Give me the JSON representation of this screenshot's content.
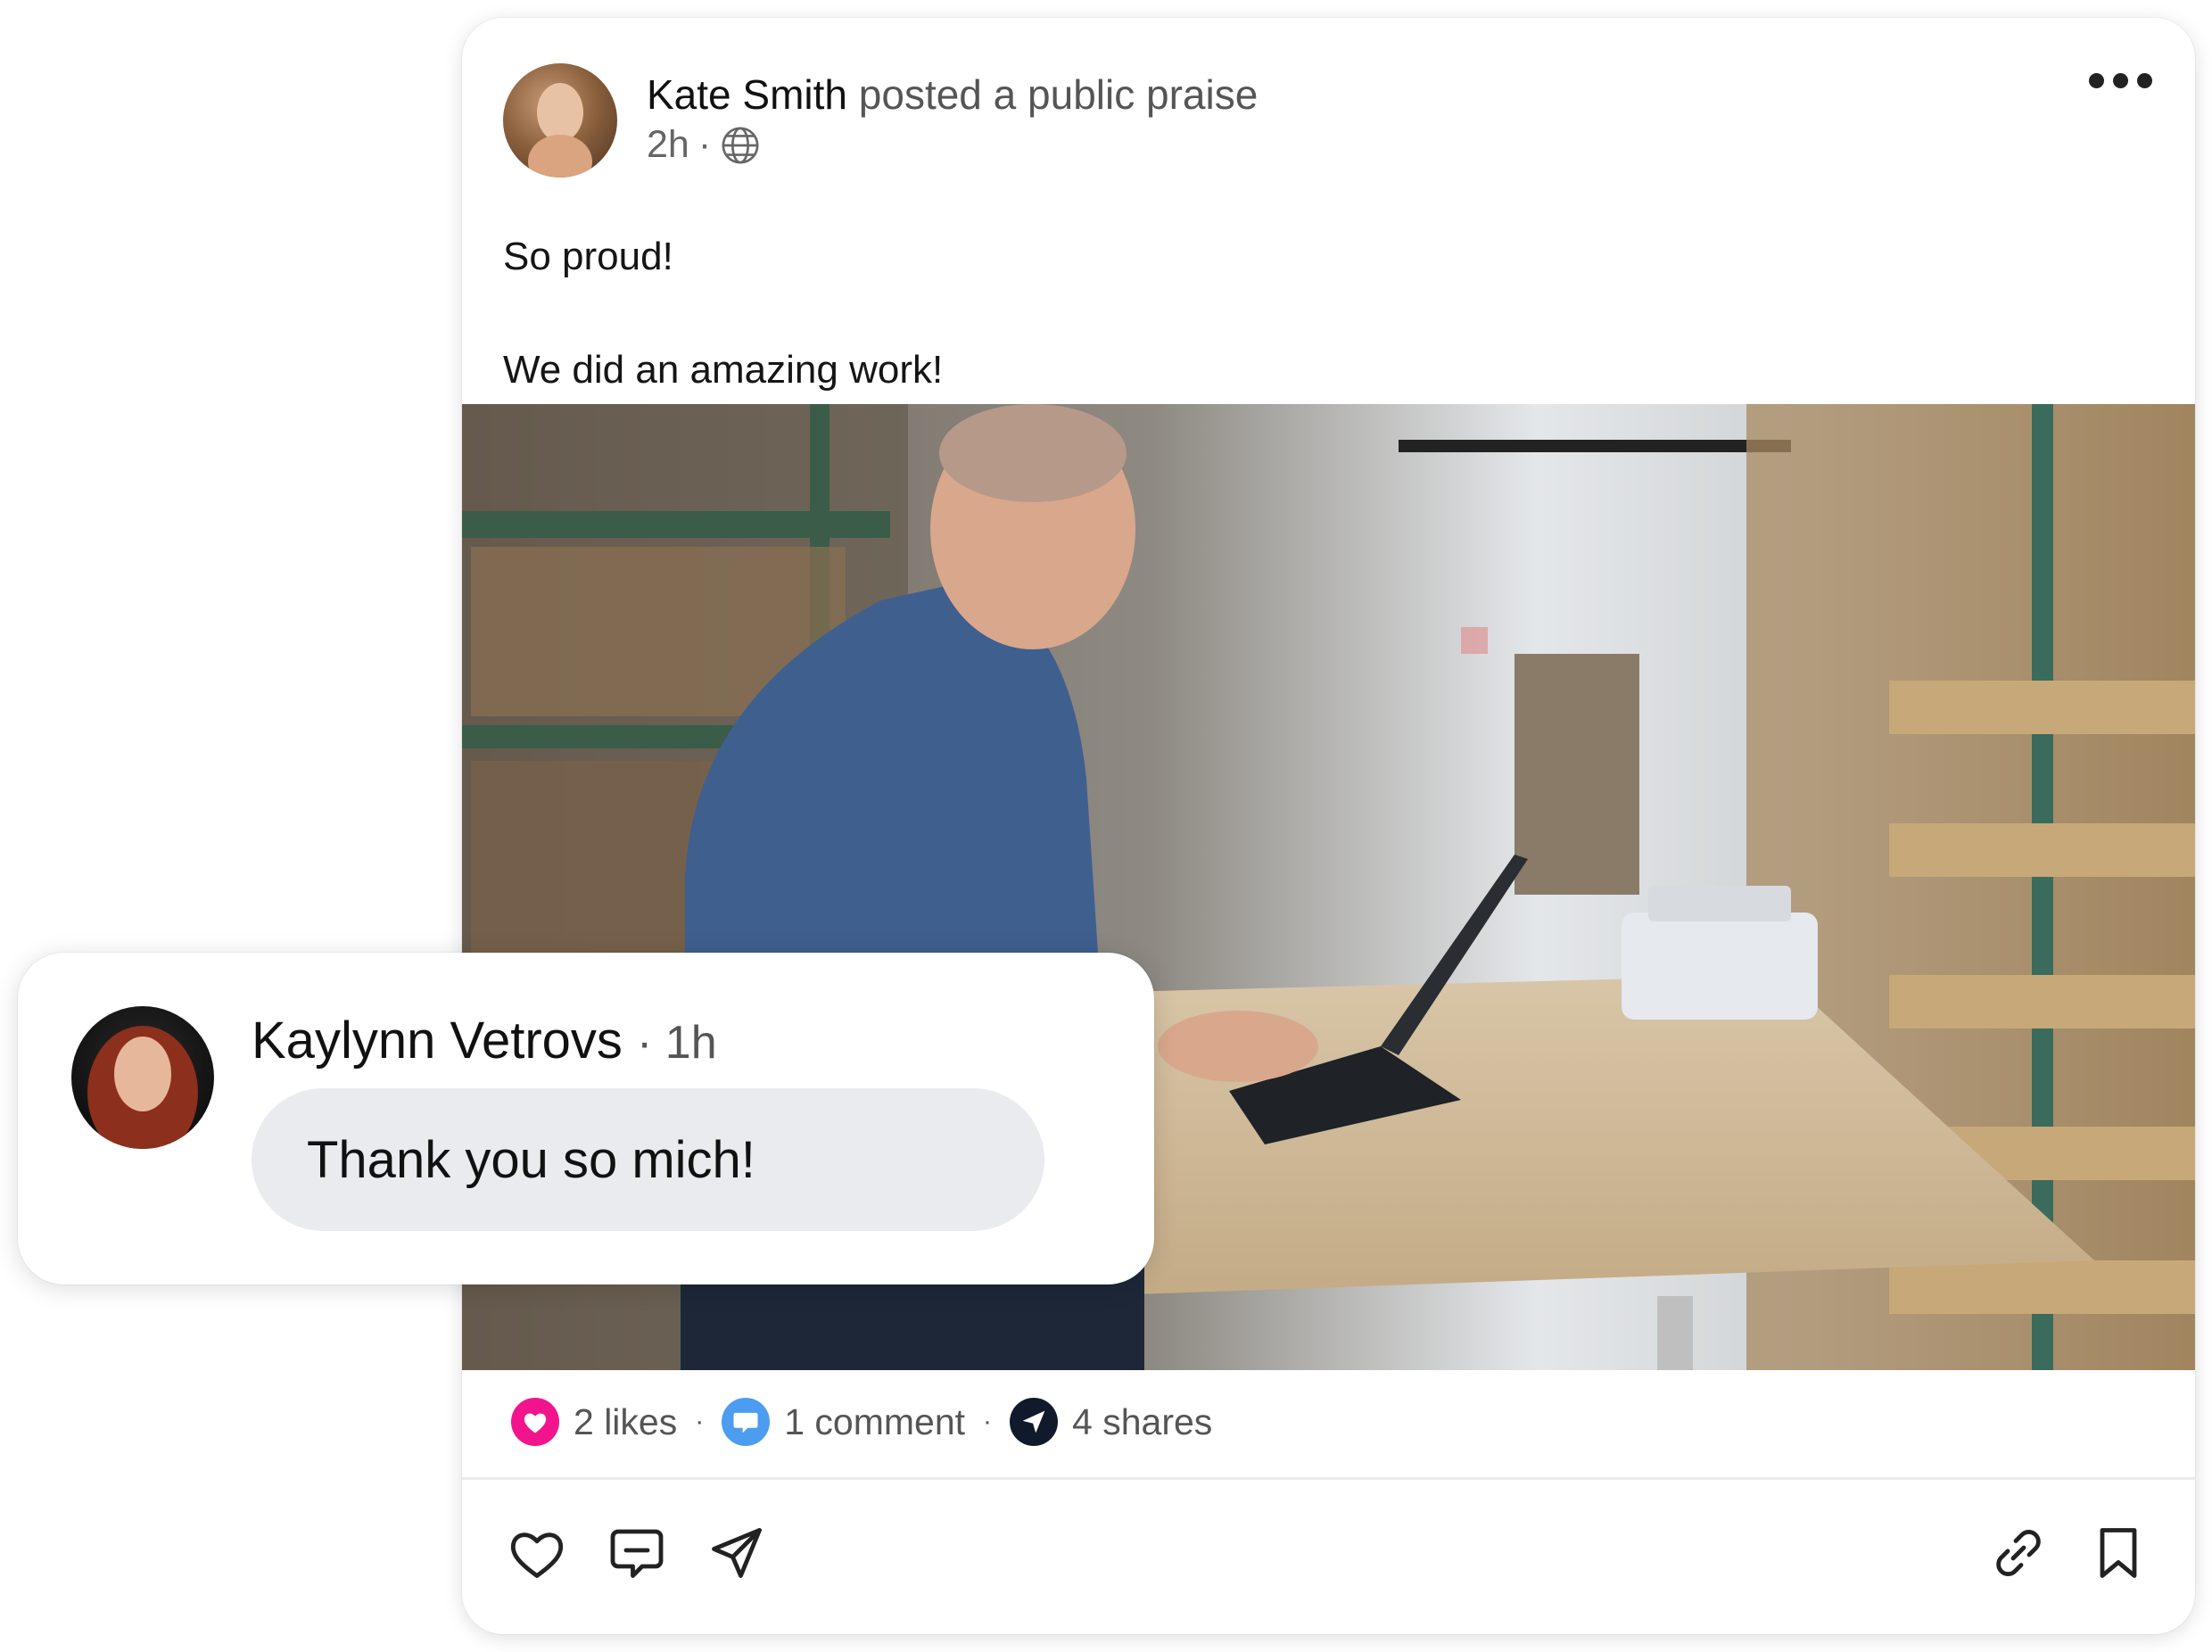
{
  "post": {
    "author_name": "Kate Smith",
    "action_text": "posted a public praise",
    "time": "2h",
    "meta_sep": "·",
    "visibility_icon": "globe-icon",
    "lines": [
      "So proud!",
      "We did an amazing work!"
    ],
    "image_subject": "man-with-laptop-in-warehouse",
    "stats": {
      "likes": "2 likes",
      "comments": "1 comment",
      "shares": "4 shares",
      "sep": "·"
    },
    "actions": [
      "heart-icon",
      "comment-icon",
      "send-icon",
      "link-icon",
      "bookmark-icon"
    ]
  },
  "comment": {
    "author_name": "Kaylynn Vetrovs",
    "time": "· 1h",
    "text": "Thank you so mich!"
  },
  "colors": {
    "like": "#f2148d",
    "comment": "#4c9df0",
    "share": "#111a2c",
    "bubble": "#e9ebef"
  }
}
